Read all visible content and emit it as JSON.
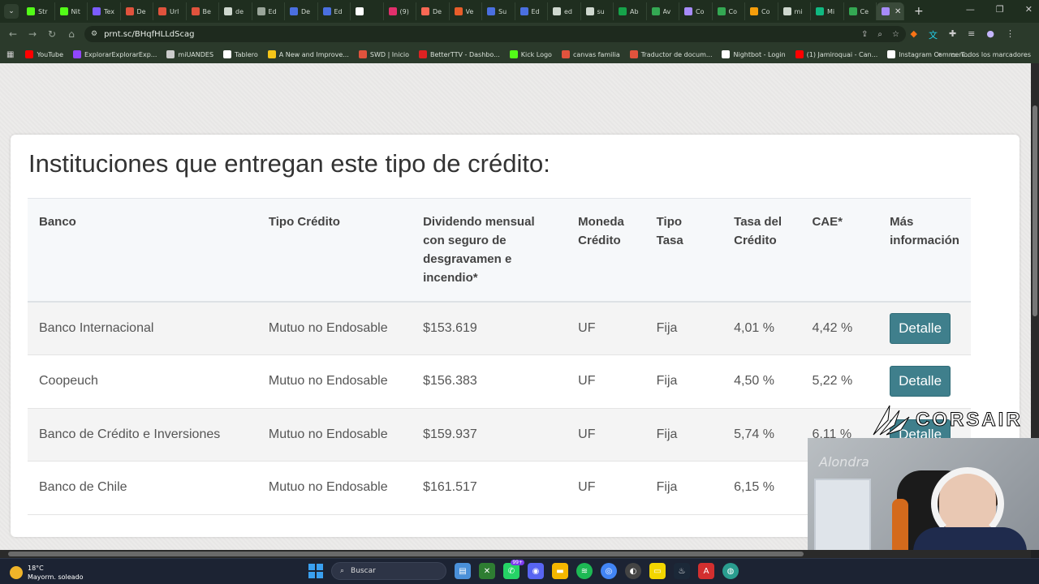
{
  "browser": {
    "tabs": [
      {
        "label": "Str",
        "color": "#53fc18"
      },
      {
        "label": "Nit",
        "color": "#53fc18"
      },
      {
        "label": "Tex",
        "color": "#7b5cff"
      },
      {
        "label": "De",
        "color": "#e0533d"
      },
      {
        "label": "Url",
        "color": "#e0533d"
      },
      {
        "label": "Be",
        "color": "#e0533d"
      },
      {
        "label": "de",
        "color": "#cfd8cf"
      },
      {
        "label": "Ed",
        "color": "#9aa59a"
      },
      {
        "label": "De",
        "color": "#4a6fe0"
      },
      {
        "label": "Ed",
        "color": "#4a6fe0"
      },
      {
        "label": "",
        "color": "#ffffff"
      },
      {
        "label": "(9)",
        "color": "#e1306c"
      },
      {
        "label": "De",
        "color": "#f96854"
      },
      {
        "label": "Ve",
        "color": "#e85d2a"
      },
      {
        "label": "Su",
        "color": "#4a6fe0"
      },
      {
        "label": "Ed",
        "color": "#4a6fe0"
      },
      {
        "label": "ed",
        "color": "#cfd8cf"
      },
      {
        "label": "su",
        "color": "#cfd8cf"
      },
      {
        "label": "Ab",
        "color": "#16a34a"
      },
      {
        "label": "Av",
        "color": "#34a853"
      },
      {
        "label": "Co",
        "color": "#a78bfa"
      },
      {
        "label": "Co",
        "color": "#34a853"
      },
      {
        "label": "Co",
        "color": "#f59e0b"
      },
      {
        "label": "mi",
        "color": "#cfd8cf"
      },
      {
        "label": "Mi",
        "color": "#10b981"
      },
      {
        "label": "Ce",
        "color": "#34a853"
      }
    ],
    "active_tab_color": "#a78bfa",
    "url": "prnt.sc/BHqfHLLdScag",
    "bookmarks": [
      {
        "label": "YouTube",
        "color": "#ff0000"
      },
      {
        "label": "ExplorarExplorarExp...",
        "color": "#9146ff"
      },
      {
        "label": "miUANDES",
        "color": "#cccccc"
      },
      {
        "label": "Tablero",
        "color": "#ffffff"
      },
      {
        "label": "A New and Improve...",
        "color": "#f5c518"
      },
      {
        "label": "SWD | Inicio",
        "color": "#e0533d"
      },
      {
        "label": "BetterTTV - Dashbo...",
        "color": "#d22"
      },
      {
        "label": "Kick Logo",
        "color": "#53fc18"
      },
      {
        "label": "canvas familia",
        "color": "#e0533d"
      },
      {
        "label": "Traductor de docum...",
        "color": "#e0533d"
      },
      {
        "label": "Nightbot - Login",
        "color": "#ffffff"
      },
      {
        "label": "(1) Jamiroquai - Can...",
        "color": "#ff0000"
      },
      {
        "label": "Instagram Commen...",
        "color": "#ffffff"
      }
    ],
    "all_bookmarks_label": "Todos los marcadores"
  },
  "page": {
    "heading": "Instituciones que entregan este tipo de crédito:",
    "table": {
      "headers": [
        "Banco",
        "Tipo Crédito",
        "Dividendo mensual con seguro de desgravamen e incendio*",
        "Moneda Crédito",
        "Tipo Tasa",
        "Tasa del Crédito",
        "CAE*",
        "Más información"
      ],
      "rows": [
        {
          "banco": "Banco Internacional",
          "tipo": "Mutuo no Endosable",
          "dividendo": "$153.619",
          "moneda": "UF",
          "tasa_tipo": "Fija",
          "tasa": "4,01 %",
          "cae": "4,42 %",
          "accion": "Detalle"
        },
        {
          "banco": "Coopeuch",
          "tipo": "Mutuo no Endosable",
          "dividendo": "$156.383",
          "moneda": "UF",
          "tasa_tipo": "Fija",
          "tasa": "4,50 %",
          "cae": "5,22 %",
          "accion": "Detalle"
        },
        {
          "banco": "Banco de Crédito e Inversiones",
          "tipo": "Mutuo no Endosable",
          "dividendo": "$159.937",
          "moneda": "UF",
          "tasa_tipo": "Fija",
          "tasa": "5,74 %",
          "cae": "6,11 %",
          "accion": "Detalle"
        },
        {
          "banco": "Banco de Chile",
          "tipo": "Mutuo no Endosable",
          "dividendo": "$161.517",
          "moneda": "UF",
          "tasa_tipo": "Fija",
          "tasa": "6,15 %",
          "cae": "",
          "accion": ""
        }
      ]
    }
  },
  "overlay": {
    "brand": "CORSAIR",
    "webcam_sign": "Alondra"
  },
  "taskbar": {
    "temperature": "18°C",
    "weather": "Mayorm. soleado",
    "search_label": "Buscar",
    "chat_badge": "99+"
  }
}
